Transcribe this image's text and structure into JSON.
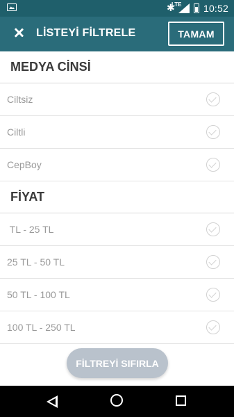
{
  "status_bar": {
    "time": "10:52",
    "network": "LTE"
  },
  "app_bar": {
    "title": "LİSTEYİ FİLTRELE",
    "ok_label": "TAMAM"
  },
  "sections": [
    {
      "title": "MEDYA CİNSİ",
      "items": [
        "Ciltsiz",
        "Ciltli",
        "CepBoy"
      ]
    },
    {
      "title": "FİYAT",
      "items": [
        " TL - 25 TL",
        "25 TL - 50 TL",
        "50 TL - 100 TL",
        "100 TL - 250 TL"
      ]
    }
  ],
  "reset_label": "FİLTREYİ SIFIRLA",
  "icons": {
    "close": "close-icon",
    "check": "check-circle-icon",
    "back": "nav-back-icon",
    "home": "nav-home-icon",
    "recent": "nav-recent-icon"
  },
  "colors": {
    "status_bar": "#1f5f6b",
    "app_bar": "#2a6c7a",
    "reset_button": "#b9c2cc"
  }
}
